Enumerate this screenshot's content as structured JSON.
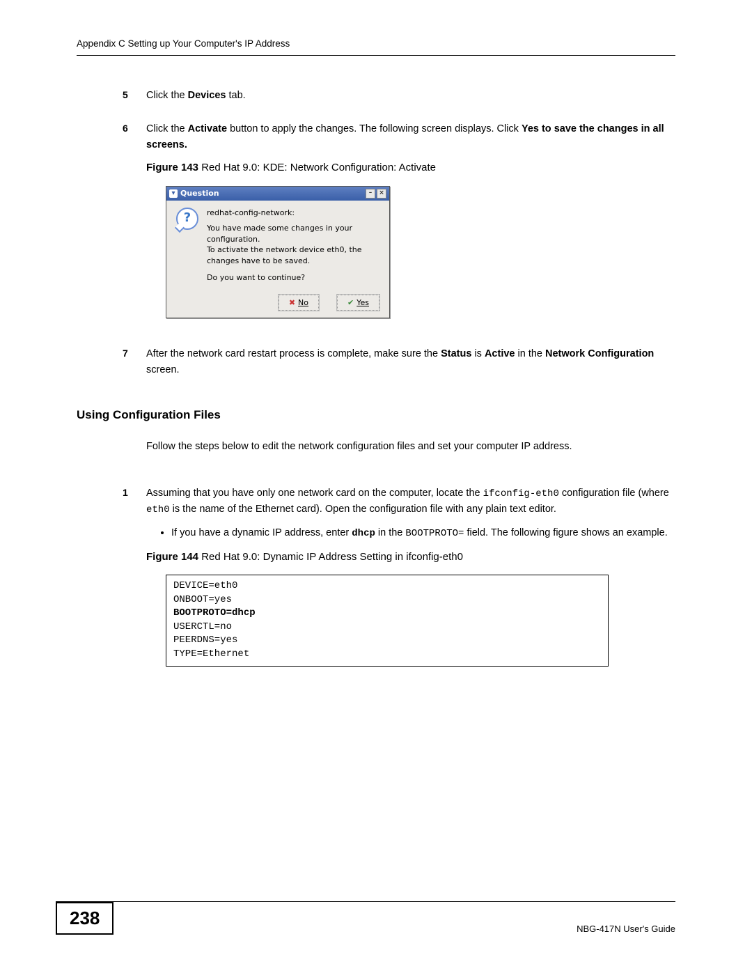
{
  "header": "Appendix C Setting up Your Computer's IP Address",
  "steps_a": {
    "s5": {
      "num": "5",
      "pre": "Click the ",
      "bold": "Devices",
      "post": " tab."
    },
    "s6": {
      "num": "6",
      "pre": "Click the ",
      "bold1": "Activate",
      "mid": " button to apply the changes. The following screen displays. Click ",
      "bold2": "Yes to save the changes in all screens."
    },
    "s7": {
      "num": "7",
      "pre": "After the network card restart process is complete, make sure the ",
      "b1": "Status",
      "mid1": " is ",
      "b2": "Active",
      "mid2": " in the ",
      "b3": "Network Configuration",
      "post": " screen."
    }
  },
  "fig143": {
    "label": "Figure 143",
    "caption": "   Red Hat 9.0: KDE: Network Configuration: Activate"
  },
  "dialog": {
    "title": "Question",
    "prog": "redhat-config-network:",
    "line1": "You have made some changes in your configuration.",
    "line2": "To activate the network device eth0, the changes have to be saved.",
    "line3": "Do you want to continue?",
    "no_label": "No",
    "yes_label": "Yes"
  },
  "section_title": "Using Configuration Files",
  "intro": "Follow the steps below to edit the network configuration files and set your computer IP address.",
  "steps_b": {
    "s1": {
      "num": "1",
      "pre": "Assuming that you have only one network card on the computer, locate the ",
      "code1": "ifconfig-eth0",
      "mid1": " configuration file (where ",
      "code2": "eth0",
      "mid2": " is the name of the Ethernet card). Open the configuration file with any plain text editor."
    },
    "bullet": {
      "pre": "If you have a dynamic IP address, enter ",
      "codeb": "dhcp",
      "mid": " in the ",
      "code2": "BOOTPROTO=",
      "post": " field. The following figure shows an example."
    }
  },
  "fig144": {
    "label": "Figure 144",
    "caption": "   Red Hat 9.0: Dynamic IP Address Setting in ifconfig-eth0"
  },
  "codebox": {
    "l1": "DEVICE=eth0",
    "l2": "ONBOOT=yes",
    "l3": "BOOTPROTO=dhcp",
    "l4": "USERCTL=no",
    "l5": "PEERDNS=yes",
    "l6": "TYPE=Ethernet"
  },
  "footer": {
    "page": "238",
    "guide": "NBG-417N User's Guide"
  }
}
